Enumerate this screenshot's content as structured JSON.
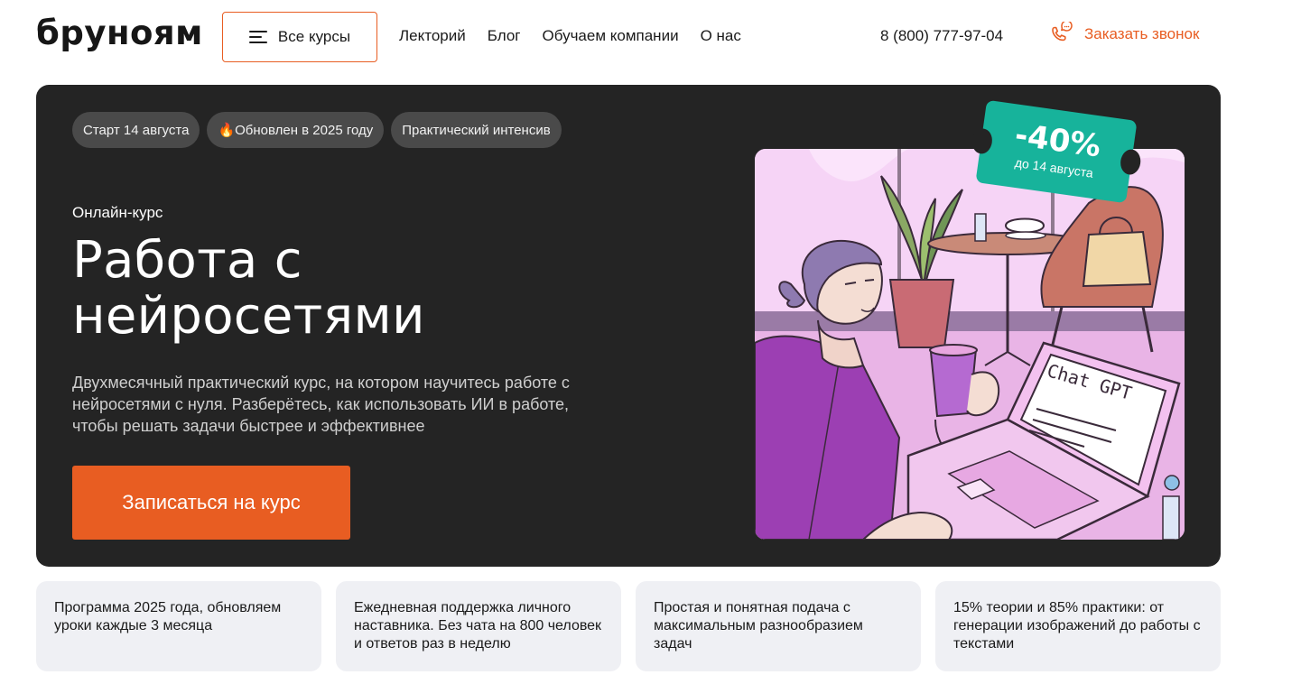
{
  "header": {
    "logo": "бруноям",
    "all_courses_label": "Все курсы",
    "nav": [
      "Лекторий",
      "Блог",
      "Обучаем компании",
      "О нас"
    ],
    "phone": "8 (800) 777-97-04",
    "callback_label": "Заказать звонок",
    "accent_color": "#e85d22"
  },
  "hero": {
    "tags": [
      "Старт 14 августа",
      "🔥Обновлен в 2025 году",
      "Практический интенсив"
    ],
    "kicker": "Онлайн-курс",
    "title": "Работа с нейросетями",
    "description": "Двухмесячный практический курс, на котором научитесь работе с нейросетями с нуля. Разберётесь, как использовать ИИ в работе, чтобы решать задачи быстрее и эффективнее",
    "cta_label": "Записаться на курс",
    "badge": {
      "value": "-40%",
      "subtitle": "до 14 августа",
      "color": "#17b39b"
    },
    "illustration": {
      "laptop_text": "Chat GPT"
    },
    "background_color": "#242424"
  },
  "features": [
    "Программа 2025 года, обновляем уроки каждые 3 месяца",
    "Ежедневная поддержка личного наставника. Без чата на 800 человек и ответов раз в неделю",
    "Простая и понятная подача с максимальным разнообразием задач",
    "15% теории и 85% практики: от генерации изображений до работы с текстами"
  ]
}
